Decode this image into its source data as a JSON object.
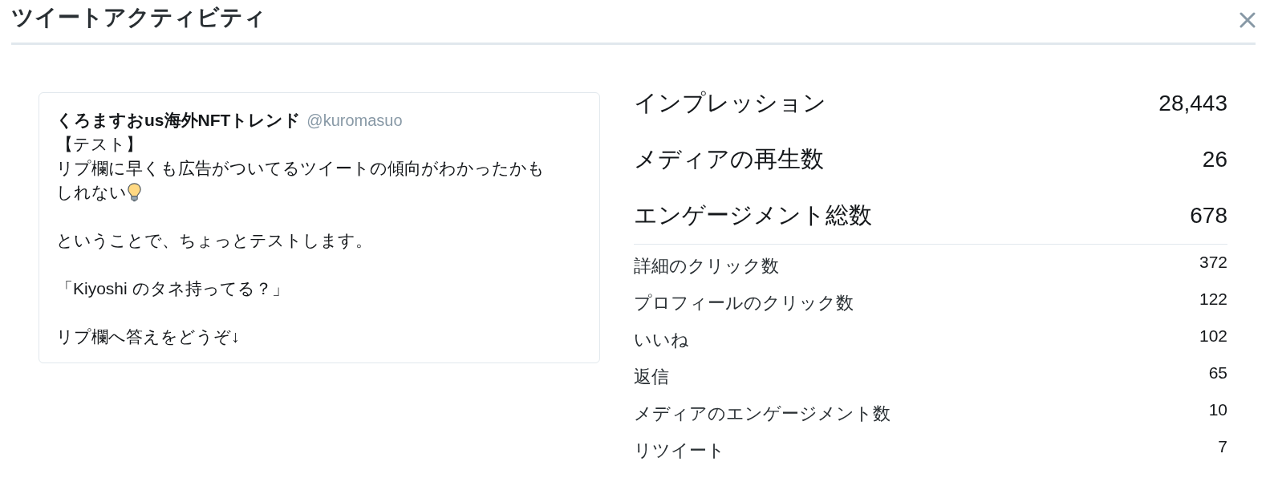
{
  "dialog": {
    "title": "ツイートアクティビティ"
  },
  "tweet": {
    "display_name": "くろますおus海外NFTトレンド",
    "handle": "@kuromasuo",
    "paragraphs": [
      {
        "lines": [
          "【テスト】",
          "リプ欄に早くも広告がついてるツイートの傾向がわかったかも",
          "しれない"
        ],
        "trailing_icon": true
      },
      {
        "lines": [
          "ということで、ちょっとテストします。"
        ],
        "trailing_icon": false
      },
      {
        "lines": [
          "「Kiyoshi のタネ持ってる？」"
        ],
        "trailing_icon": false
      },
      {
        "lines": [
          "リプ欄へ答えをどうぞ↓"
        ],
        "trailing_icon": false
      }
    ]
  },
  "metrics": {
    "primary": [
      {
        "label": "インプレッション",
        "value": "28,443"
      },
      {
        "label": "メディアの再生数",
        "value": "26"
      },
      {
        "label": "エンゲージメント総数",
        "value": "678"
      }
    ],
    "details": [
      {
        "label": "詳細のクリック数",
        "value": "372"
      },
      {
        "label": "プロフィールのクリック数",
        "value": "122"
      },
      {
        "label": "いいね",
        "value": "102"
      },
      {
        "label": "返信",
        "value": "65"
      },
      {
        "label": "メディアのエンゲージメント数",
        "value": "10"
      },
      {
        "label": "リツイート",
        "value": "7"
      }
    ]
  }
}
